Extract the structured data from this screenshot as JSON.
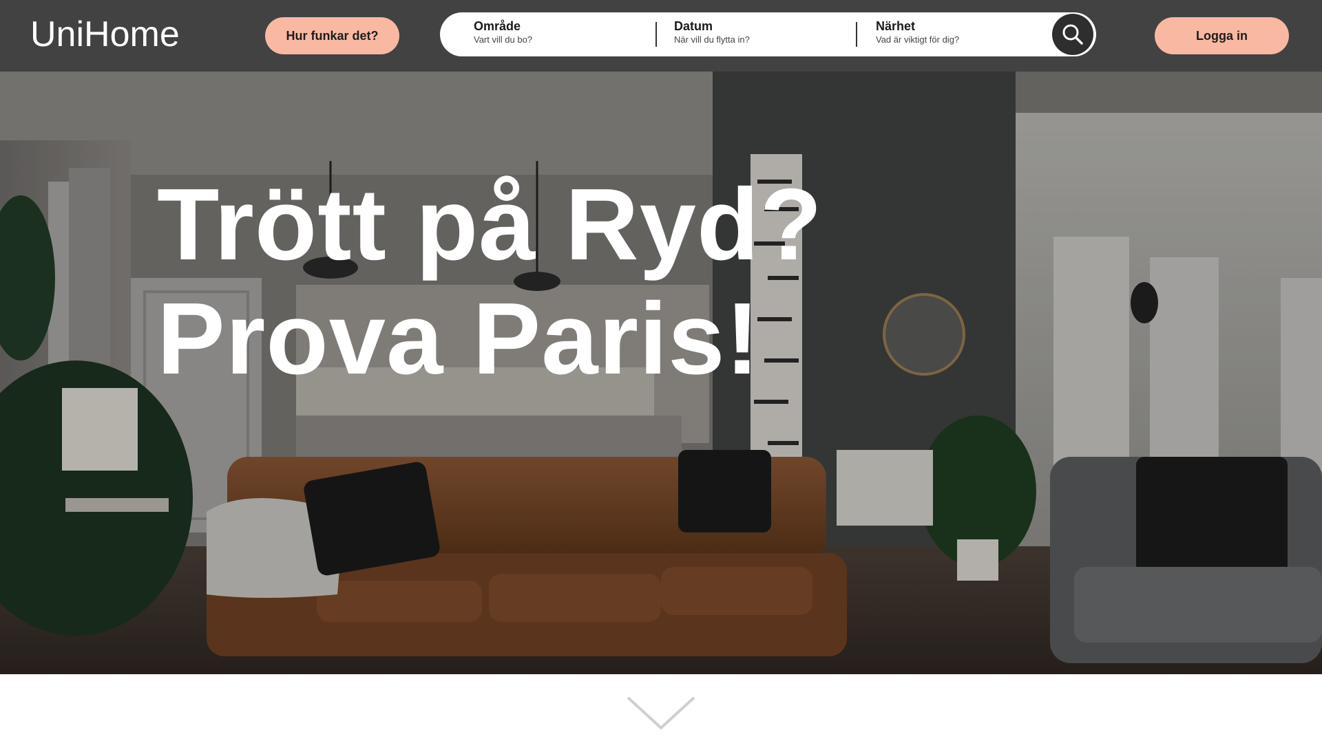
{
  "header": {
    "logo": "UniHome",
    "how_it_works_label": "Hur funkar det?",
    "login_label": "Logga in",
    "search": {
      "fields": [
        {
          "label": "Område",
          "placeholder": "Vart vill du bo?"
        },
        {
          "label": "Datum",
          "placeholder": "När vill du flytta in?"
        },
        {
          "label": "Närhet",
          "placeholder": "Vad är viktigt för dig?"
        }
      ],
      "button_icon": "search-icon"
    }
  },
  "hero": {
    "headline_line1": "Trött på Ryd?",
    "headline_line2": "Prova Paris!",
    "background": "living-room-photo"
  },
  "scroll_indicator_icon": "chevron-down-icon",
  "colors": {
    "header_bg": "#424242",
    "accent": "#f8b8a2",
    "page_bg": "#ffffff"
  }
}
